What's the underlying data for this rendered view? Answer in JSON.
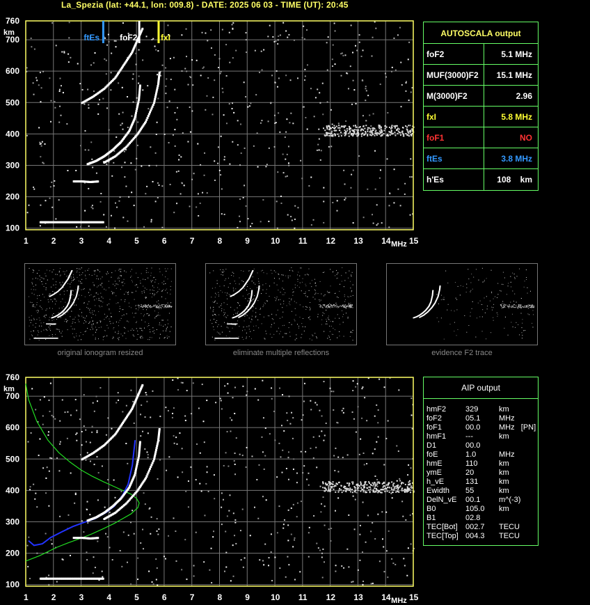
{
  "header": "La_Spezia (lat: +44.1, lon: 009.8) - DATE: 2025 06 03 - TIME (UT): 20:45",
  "colors": {
    "grid": "#777777",
    "axis": "#ffff66",
    "ftEs": "#3399ff",
    "foF2": "#ffffff",
    "fxI": "#ffff33",
    "table": "#66ff66",
    "foF1": "#ff3333",
    "model": "#22dd22",
    "profile": "#2233ff"
  },
  "chart_data": [
    {
      "type": "scatter",
      "title": "",
      "xlabel": "MHz",
      "ylabel": "km",
      "xlim": [
        1,
        15
      ],
      "ylim": [
        95,
        760
      ],
      "x_ticks": [
        1,
        2,
        3,
        4,
        5,
        6,
        7,
        8,
        9,
        10,
        11,
        12,
        13,
        14,
        15
      ],
      "y_ticks": [
        100,
        200,
        300,
        400,
        500,
        600,
        700,
        760
      ],
      "markers": [
        {
          "label": "ftEs",
          "x": 3.8,
          "color": "#3399ff"
        },
        {
          "label": "foF2",
          "x": 5.1,
          "color": "#ffffff"
        },
        {
          "label": "fxI",
          "x": 5.8,
          "color": "#ffff33"
        }
      ],
      "traces": [
        {
          "name": "",
          "x": [
            3.2,
            3.5,
            3.8,
            4.1,
            4.4,
            4.7,
            4.9,
            5.05,
            5.1
          ],
          "y": [
            305,
            315,
            330,
            350,
            375,
            410,
            450,
            510,
            560
          ]
        },
        {
          "name": "",
          "x": [
            3.8,
            4.2,
            4.6,
            5.0,
            5.3,
            5.6,
            5.75,
            5.8
          ],
          "y": [
            310,
            330,
            360,
            400,
            440,
            500,
            560,
            600
          ]
        },
        {
          "name": "",
          "x": [
            1.5,
            1.8,
            2.2,
            2.6,
            3.0,
            3.4,
            3.8
          ],
          "y": [
            120,
            120,
            120,
            120,
            120,
            120,
            120
          ]
        },
        {
          "name": "",
          "x": [
            2.7,
            3.0,
            3.3,
            3.6
          ],
          "y": [
            250,
            250,
            248,
            250
          ]
        },
        {
          "name": "",
          "x": [
            3.0,
            3.4,
            3.8,
            4.2,
            4.5,
            4.8,
            5.0,
            5.2
          ],
          "y": [
            500,
            520,
            545,
            580,
            620,
            660,
            700,
            740
          ]
        }
      ]
    },
    {
      "type": "line",
      "title": "",
      "xlabel": "MHz",
      "ylabel": "km",
      "xlim": [
        1,
        15
      ],
      "ylim": [
        95,
        760
      ],
      "x_ticks": [
        1,
        2,
        3,
        4,
        5,
        6,
        7,
        8,
        9,
        10,
        11,
        12,
        13,
        14,
        15
      ],
      "y_ticks": [
        100,
        200,
        300,
        400,
        500,
        600,
        700,
        760
      ],
      "series": [
        {
          "name": "",
          "color": "#22dd22",
          "x": [
            1.0,
            1.2,
            1.5,
            1.8,
            2.1,
            2.5,
            3.0,
            3.4,
            3.8,
            4.2,
            4.5,
            4.8,
            5.05,
            5.1,
            5.0,
            4.8,
            4.5,
            4.2,
            3.8,
            3.4,
            3.0,
            2.6,
            2.2,
            1.8,
            1.4,
            1.1,
            1.0
          ],
          "y": [
            175,
            182,
            192,
            205,
            218,
            232,
            248,
            262,
            278,
            295,
            310,
            325,
            345,
            360,
            375,
            388,
            400,
            412,
            428,
            445,
            465,
            490,
            520,
            560,
            620,
            690,
            740
          ]
        },
        {
          "name": "",
          "color": "#2233ff",
          "x": [
            1.1,
            1.3,
            1.6,
            1.9,
            2.3,
            2.7,
            3.1,
            3.5,
            3.9,
            4.2,
            4.5,
            4.7,
            4.85,
            4.95
          ],
          "y": [
            240,
            225,
            230,
            250,
            268,
            285,
            298,
            310,
            330,
            350,
            385,
            420,
            480,
            560
          ]
        }
      ]
    }
  ],
  "autoscala": {
    "title": "AUTOSCALA output",
    "rows": [
      {
        "key": "foF2",
        "value": "5.1 MHz",
        "color": "#ffffff"
      },
      {
        "key": "MUF(3000)F2",
        "value": "15.1 MHz",
        "color": "#ffffff"
      },
      {
        "key": "M(3000)F2",
        "value": "2.96",
        "color": "#ffffff"
      },
      {
        "key": "fxI",
        "value": "5.8 MHz",
        "color": "#ffff33"
      },
      {
        "key": "foF1",
        "value": "NO",
        "color": "#ff3333"
      },
      {
        "key": "ftEs",
        "value": "3.8 MHz",
        "color": "#3399ff"
      },
      {
        "key": "h'Es",
        "value": "108    km",
        "color": "#ffffff"
      }
    ]
  },
  "aip": {
    "title": "AIP output",
    "rows": [
      {
        "k": "hmF2",
        "v": "329",
        "u": "km"
      },
      {
        "k": "foF2",
        "v": "05.1",
        "u": "MHz"
      },
      {
        "k": "foF1",
        "v": "00.0",
        "u": "MHz   [PN]"
      },
      {
        "k": "hmF1",
        "v": "---",
        "u": "km"
      },
      {
        "k": "D1",
        "v": "00.0",
        "u": ""
      },
      {
        "k": "foE",
        "v": "1.0",
        "u": "MHz"
      },
      {
        "k": "hmE",
        "v": "110",
        "u": "km"
      },
      {
        "k": "ymE",
        "v": "20",
        "u": "km"
      },
      {
        "k": "h_vE",
        "v": "131",
        "u": "km"
      },
      {
        "k": "Ewidth",
        "v": "55",
        "u": "km"
      },
      {
        "k": "DelN_vE",
        "v": "00.1",
        "u": "m^(-3)"
      },
      {
        "k": "B0",
        "v": "105.0",
        "u": "km"
      },
      {
        "k": "B1",
        "v": "02.8",
        "u": ""
      },
      {
        "k": "TEC[Bot]",
        "v": "002.7",
        "u": "TECU"
      },
      {
        "k": "TEC[Top]",
        "v": "004.3",
        "u": "TECU"
      }
    ]
  },
  "thumbnails": [
    {
      "caption": "original ionogram resized"
    },
    {
      "caption": "eliminate multiple reflections"
    },
    {
      "caption": "evidence F2 trace"
    }
  ]
}
